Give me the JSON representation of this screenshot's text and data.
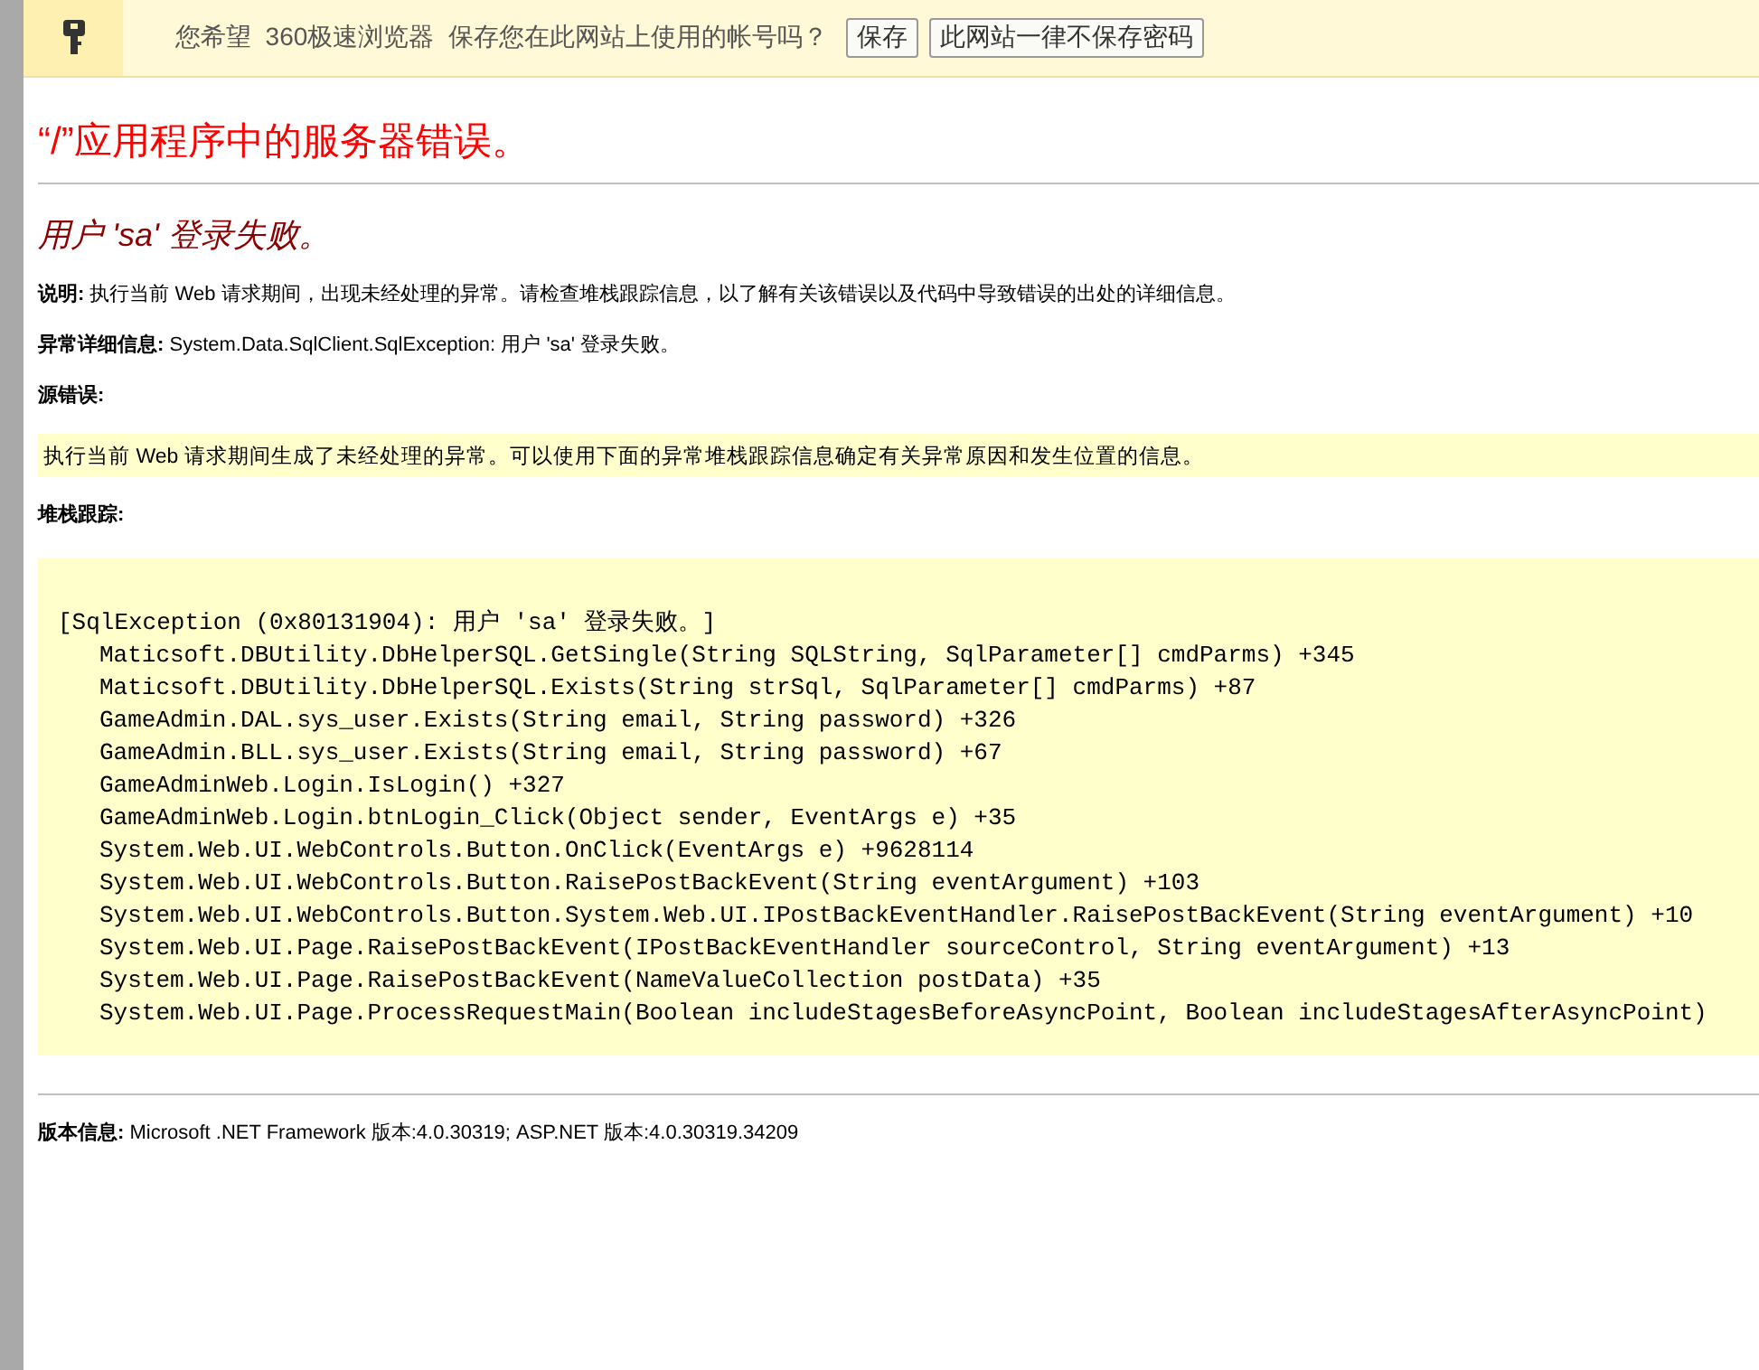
{
  "infobar": {
    "message": "您希望  360极速浏览器  保存您在此网站上使用的帐号吗？",
    "buttons": [
      "保存",
      "此网站一律不保存密码"
    ]
  },
  "title": "“/”应用程序中的服务器错误。",
  "subtitle": "用户 'sa' 登录失败。",
  "description": "**说明:** 执行当前 Web 请求期间，出现未经处理的异常。请检查堆栈跟踪信息，以了解有关该错误以及代码中导致错误的出处的详细信息。",
  "exception_details": "**异常详细信息:** System.Data.SqlClient.SqlException: 用户 'sa' 登录失败。",
  "source_error_label": "源错误:",
  "source_error_text": "执行当前 Web 请求期间生成了未经处理的异常。可以使用下面的异常堆栈跟踪信息确定有关异常原因和发生位置的信息。",
  "stack_trace_label": "堆栈跟踪:",
  "stack_trace": {
    "header": "[SqlException (0x80131904): 用户 'sa' 登录失败。]",
    "frames": [
      "Maticsoft.DBUtility.DbHelperSQL.GetSingle(String SQLString, SqlParameter[] cmdParms) +345",
      "Maticsoft.DBUtility.DbHelperSQL.Exists(String strSql, SqlParameter[] cmdParms) +87",
      "GameAdmin.DAL.sys_user.Exists(String email, String password) +326",
      "GameAdmin.BLL.sys_user.Exists(String email, String password) +67",
      "GameAdminWeb.Login.IsLogin() +327",
      "GameAdminWeb.Login.btnLogin_Click(Object sender, EventArgs e) +35",
      "System.Web.UI.WebControls.Button.OnClick(EventArgs e) +9628114",
      "System.Web.UI.WebControls.Button.RaisePostBackEvent(String eventArgument) +103",
      "System.Web.UI.WebControls.Button.System.Web.UI.IPostBackEventHandler.RaisePostBackEvent(String eventArgument) +10",
      "System.Web.UI.Page.RaisePostBackEvent(IPostBackEventHandler sourceControl, String eventArgument) +13",
      "System.Web.UI.Page.RaisePostBackEvent(NameValueCollection postData) +35",
      "System.Web.UI.Page.ProcessRequestMain(Boolean includeStagesBeforeAsyncPoint, Boolean includeStagesAfterAsyncPoint)"
    ]
  },
  "version_info": "**版本信息:** Microsoft .NET Framework 版本:4.0.30319; ASP.NET 版本:4.0.30319.34209"
}
